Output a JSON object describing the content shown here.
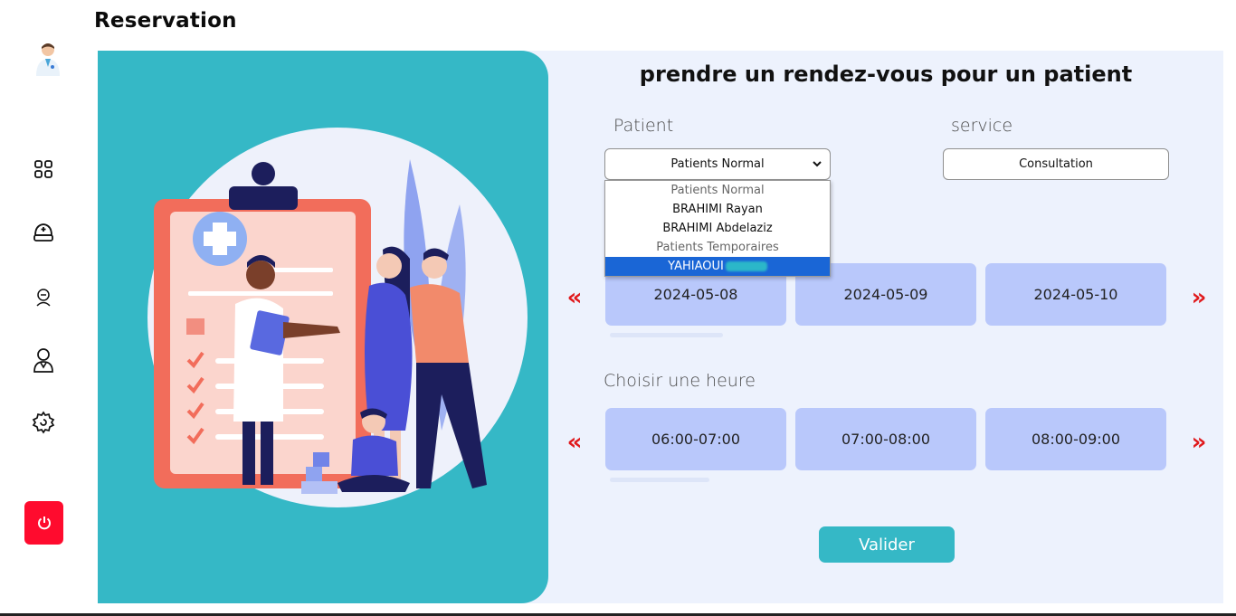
{
  "page": {
    "title": "Reservation"
  },
  "sidebar": {
    "items": [
      {
        "name": "dashboard-icon"
      },
      {
        "name": "nurse-cap-icon"
      },
      {
        "name": "patient-icon"
      },
      {
        "name": "doctor-icon"
      },
      {
        "name": "settings-icon"
      }
    ],
    "logout_icon": "power-icon"
  },
  "form": {
    "heading": "prendre un rendez-vous pour un patient",
    "patient_label": "Patient",
    "service_label": "service",
    "patient_selected": "Patients Normal",
    "service_value": "Consultation",
    "dropdown": {
      "group1": "Patients Normal",
      "opt1": "BRAHIMI Rayan",
      "opt2": "BRAHIMI Abdelaziz",
      "group2": "Patients Temporaires",
      "opt3": "YAHIAOUI"
    },
    "dates": [
      "2024-05-08",
      "2024-05-09",
      "2024-05-10"
    ],
    "hour_label": "Choisir une heure",
    "hours": [
      "06:00-07:00",
      "07:00-08:00",
      "08:00-09:00"
    ],
    "prev_symbol": "«",
    "next_symbol": "»",
    "submit_label": "Valider"
  },
  "colors": {
    "accent": "#35b8c6",
    "tile": "#b9c8fb",
    "logout": "#ff0b2e",
    "arrow": "#e0191c"
  }
}
